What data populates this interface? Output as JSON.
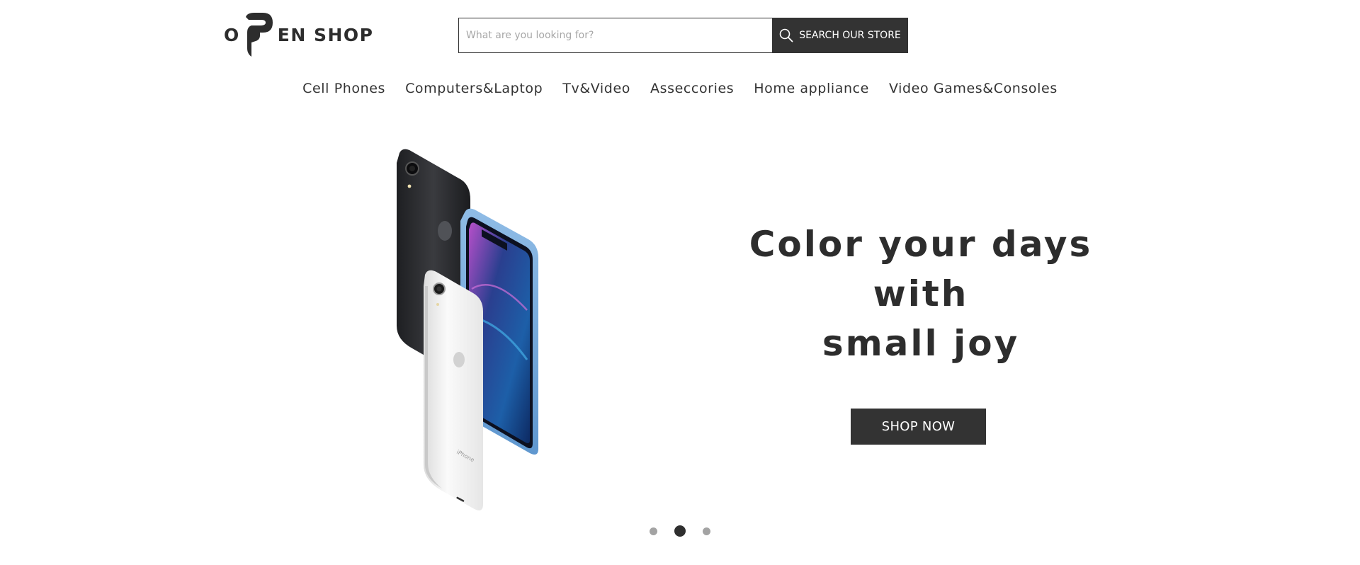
{
  "brand": {
    "logo_left": "O",
    "logo_right": "EN SHOP",
    "color": "#2d2d2d"
  },
  "search": {
    "placeholder": "What are you looking for?",
    "value": "",
    "button_label": "SEARCH OUR STORE",
    "button_icon": "search-icon"
  },
  "nav": {
    "items": [
      {
        "label": "Cell Phones"
      },
      {
        "label": "Computers&Laptop"
      },
      {
        "label": "Tv&Video"
      },
      {
        "label": "Asseccories"
      },
      {
        "label": "Home appliance"
      },
      {
        "label": "Video Games&Consoles"
      }
    ]
  },
  "hero": {
    "heading_line1": "Color your days with",
    "heading_line2": "small joy",
    "cta_label": "SHOP NOW",
    "image_icon": "phones-image"
  },
  "slider": {
    "count": 3,
    "active_index": 2
  },
  "colors": {
    "dark": "#333333",
    "text": "#2d2d2d",
    "dot_inactive": "#a3a3a3",
    "background": "#ffffff"
  }
}
